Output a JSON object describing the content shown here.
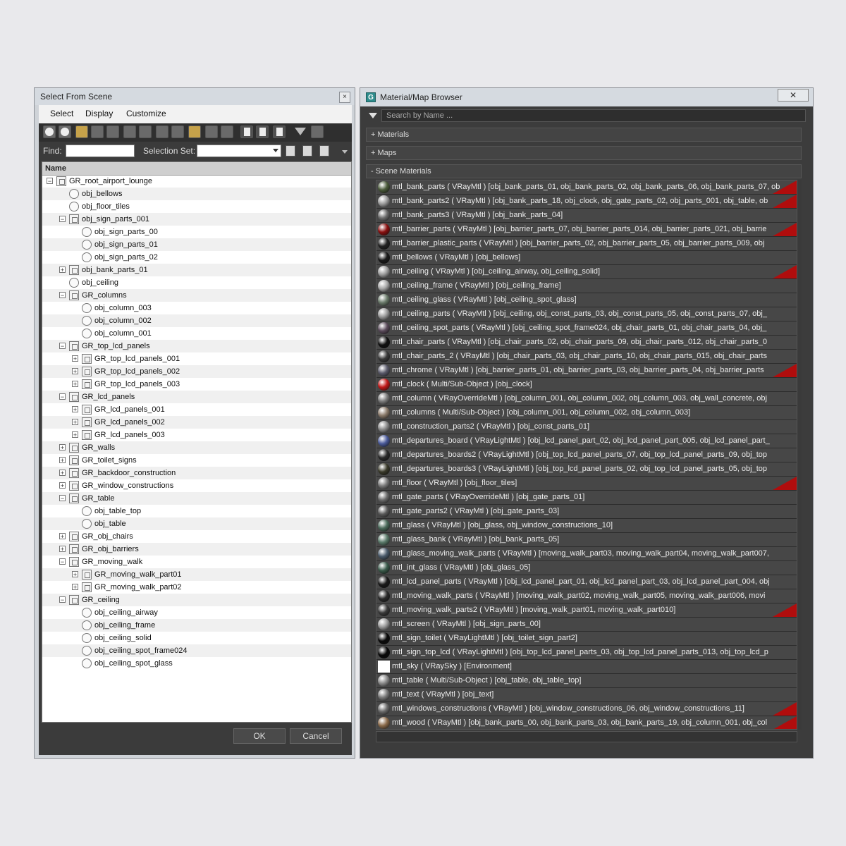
{
  "select_from_scene": {
    "title": "Select From Scene",
    "close": "×",
    "menu": [
      "Select",
      "Display",
      "Customize"
    ],
    "find_label": "Find:",
    "selection_set_label": "Selection Set:",
    "column_header": "Name",
    "buttons": {
      "ok": "OK",
      "cancel": "Cancel"
    },
    "tree": [
      {
        "name": "GR_root_airport_lounge",
        "level": 0,
        "type": "group",
        "expander": "−"
      },
      {
        "name": "obj_bellows",
        "level": 1,
        "type": "object",
        "expander": ""
      },
      {
        "name": "obj_floor_tiles",
        "level": 1,
        "type": "object",
        "expander": ""
      },
      {
        "name": "obj_sign_parts_001",
        "level": 1,
        "type": "group",
        "expander": "−"
      },
      {
        "name": "obj_sign_parts_00",
        "level": 2,
        "type": "object",
        "expander": ""
      },
      {
        "name": "obj_sign_parts_01",
        "level": 2,
        "type": "object",
        "expander": ""
      },
      {
        "name": "obj_sign_parts_02",
        "level": 2,
        "type": "object",
        "expander": ""
      },
      {
        "name": "obj_bank_parts_01",
        "level": 1,
        "type": "group",
        "expander": "+"
      },
      {
        "name": "obj_ceiling",
        "level": 1,
        "type": "object",
        "expander": ""
      },
      {
        "name": "GR_columns",
        "level": 1,
        "type": "group",
        "expander": "−"
      },
      {
        "name": "obj_column_003",
        "level": 2,
        "type": "object",
        "expander": ""
      },
      {
        "name": "obj_column_002",
        "level": 2,
        "type": "object",
        "expander": ""
      },
      {
        "name": "obj_column_001",
        "level": 2,
        "type": "object",
        "expander": ""
      },
      {
        "name": "GR_top_lcd_panels",
        "level": 1,
        "type": "group",
        "expander": "−"
      },
      {
        "name": "GR_top_lcd_panels_001",
        "level": 2,
        "type": "group",
        "expander": "+"
      },
      {
        "name": "GR_top_lcd_panels_002",
        "level": 2,
        "type": "group",
        "expander": "+"
      },
      {
        "name": "GR_top_lcd_panels_003",
        "level": 2,
        "type": "group",
        "expander": "+"
      },
      {
        "name": "GR_lcd_panels",
        "level": 1,
        "type": "group",
        "expander": "−"
      },
      {
        "name": "GR_lcd_panels_001",
        "level": 2,
        "type": "group",
        "expander": "+"
      },
      {
        "name": "GR_lcd_panels_002",
        "level": 2,
        "type": "group",
        "expander": "+"
      },
      {
        "name": "GR_lcd_panels_003",
        "level": 2,
        "type": "group",
        "expander": "+"
      },
      {
        "name": "GR_walls",
        "level": 1,
        "type": "group",
        "expander": "+"
      },
      {
        "name": "GR_toilet_signs",
        "level": 1,
        "type": "group",
        "expander": "+"
      },
      {
        "name": "GR_backdoor_construction",
        "level": 1,
        "type": "group",
        "expander": "+"
      },
      {
        "name": "GR_window_constructions",
        "level": 1,
        "type": "group",
        "expander": "+"
      },
      {
        "name": "GR_table",
        "level": 1,
        "type": "group",
        "expander": "−"
      },
      {
        "name": "obj_table_top",
        "level": 2,
        "type": "object",
        "expander": ""
      },
      {
        "name": "obj_table",
        "level": 2,
        "type": "object",
        "expander": ""
      },
      {
        "name": "GR_obj_chairs",
        "level": 1,
        "type": "group",
        "expander": "+"
      },
      {
        "name": "GR_obj_barriers",
        "level": 1,
        "type": "group",
        "expander": "+"
      },
      {
        "name": "GR_moving_walk",
        "level": 1,
        "type": "group",
        "expander": "−"
      },
      {
        "name": "GR_moving_walk_part01",
        "level": 2,
        "type": "group",
        "expander": "+"
      },
      {
        "name": "GR_moving_walk_part02",
        "level": 2,
        "type": "group",
        "expander": "+"
      },
      {
        "name": "GR_ceiling",
        "level": 1,
        "type": "group",
        "expander": "−"
      },
      {
        "name": "obj_ceiling_airway",
        "level": 2,
        "type": "object",
        "expander": ""
      },
      {
        "name": "obj_ceiling_frame",
        "level": 2,
        "type": "object",
        "expander": ""
      },
      {
        "name": "obj_ceiling_solid",
        "level": 2,
        "type": "object",
        "expander": ""
      },
      {
        "name": "obj_ceiling_spot_frame024",
        "level": 2,
        "type": "object",
        "expander": ""
      },
      {
        "name": "obj_ceiling_spot_glass",
        "level": 2,
        "type": "object",
        "expander": ""
      }
    ]
  },
  "material_browser": {
    "title": "Material/Map Browser",
    "close": "✕",
    "app_icon": "G",
    "search_placeholder": "Search by Name ...",
    "sections": [
      "+ Materials",
      "+ Maps",
      "- Scene Materials"
    ],
    "materials": [
      {
        "label": "mtl_bank_parts ( VRayMtl ) [obj_bank_parts_01, obj_bank_parts_02, obj_bank_parts_06, obj_bank_parts_07, ob",
        "swatch": "#4a5a3a",
        "flag": true
      },
      {
        "label": "mtl_bank_parts2 ( VRayMtl ) [obj_bank_parts_18, obj_clock, obj_gate_parts_02, obj_parts_001, obj_table, ob",
        "swatch": "#9a9a9a",
        "flag": true
      },
      {
        "label": "mtl_bank_parts3 ( VRayMtl ) [obj_bank_parts_04]",
        "swatch": "#6b6b6b",
        "flag": false
      },
      {
        "label": "mtl_barrier_parts ( VRayMtl ) [obj_barrier_parts_07, obj_barrier_parts_014, obj_barrier_parts_021, obj_barrie",
        "swatch": "#8a1010",
        "flag": true
      },
      {
        "label": "mtl_barrier_plastic_parts ( VRayMtl ) [obj_barrier_parts_02, obj_barrier_parts_05, obj_barrier_parts_009, obj",
        "swatch": "#222222",
        "flag": false
      },
      {
        "label": "mtl_bellows ( VRayMtl ) [obj_bellows]",
        "swatch": "#1a1a1a",
        "flag": false
      },
      {
        "label": "mtl_ceiling ( VRayMtl ) [obj_ceiling_airway, obj_ceiling_solid]",
        "swatch": "#9d9d9d",
        "flag": true
      },
      {
        "label": "mtl_ceiling_frame ( VRayMtl ) [obj_ceiling_frame]",
        "swatch": "#a8a8a8",
        "flag": false
      },
      {
        "label": "mtl_ceiling_glass ( VRayMtl ) [obj_ceiling_spot_glass]",
        "swatch": "#6a7a6a",
        "flag": false
      },
      {
        "label": "mtl_ceiling_parts ( VRayMtl ) [obj_ceiling, obj_const_parts_03, obj_const_parts_05, obj_const_parts_07, obj_",
        "swatch": "#9a9a9a",
        "flag": false
      },
      {
        "label": "mtl_ceiling_spot_parts ( VRayMtl ) [obj_ceiling_spot_frame024, obj_chair_parts_01, obj_chair_parts_04, obj_",
        "swatch": "#5a4a5a",
        "flag": false
      },
      {
        "label": "mtl_chair_parts ( VRayMtl ) [obj_chair_parts_02, obj_chair_parts_09, obj_chair_parts_012, obj_chair_parts_0",
        "swatch": "#111111",
        "flag": false
      },
      {
        "label": "mtl_chair_parts_2 ( VRayMtl ) [obj_chair_parts_03, obj_chair_parts_10, obj_chair_parts_015, obj_chair_parts",
        "swatch": "#3a3a3a",
        "flag": false
      },
      {
        "label": "mtl_chrome ( VRayMtl ) [obj_barrier_parts_01, obj_barrier_parts_03, obj_barrier_parts_04, obj_barrier_parts",
        "swatch": "#5a5a6a",
        "flag": true
      },
      {
        "label": "mtl_clock ( Multi/Sub-Object ) [obj_clock]",
        "swatch": "#c01818",
        "flag": false
      },
      {
        "label": "mtl_column ( VRayOverrideMtl ) [obj_column_001, obj_column_002, obj_column_003, obj_wall_concrete, obj",
        "swatch": "#7a7a7a",
        "flag": false
      },
      {
        "label": "mtl_columns ( Multi/Sub-Object ) [obj_column_001, obj_column_002, obj_column_003]",
        "swatch": "#8a7a6a",
        "flag": false
      },
      {
        "label": "mtl_construction_parts2 ( VRayMtl ) [obj_const_parts_01]",
        "swatch": "#8a8a8a",
        "flag": false
      },
      {
        "label": "mtl_departures_board ( VRayLightMtl ) [obj_lcd_panel_part_02, obj_lcd_panel_part_005, obj_lcd_panel_part_",
        "swatch": "#4a5a9a",
        "flag": false
      },
      {
        "label": "mtl_departures_boards2 ( VRayLightMtl ) [obj_top_lcd_panel_parts_07, obj_top_lcd_panel_parts_09, obj_top",
        "swatch": "#2a2a2a",
        "flag": false
      },
      {
        "label": "mtl_departures_boards3 ( VRayLightMtl ) [obj_top_lcd_panel_parts_02, obj_top_lcd_panel_parts_05, obj_top",
        "swatch": "#3a3a2a",
        "flag": false
      },
      {
        "label": "mtl_floor ( VRayMtl ) [obj_floor_tiles]",
        "swatch": "#7a7a7a",
        "flag": true
      },
      {
        "label": "mtl_gate_parts ( VRayOverrideMtl ) [obj_gate_parts_01]",
        "swatch": "#6a6a6a",
        "flag": false
      },
      {
        "label": "mtl_gate_parts2 ( VRayMtl ) [obj_gate_parts_03]",
        "swatch": "#5a5a5a",
        "flag": false
      },
      {
        "label": "mtl_glass ( VRayMtl ) [obj_glass, obj_window_constructions_10]",
        "swatch": "#4a6a5a",
        "flag": false
      },
      {
        "label": "mtl_glass_bank ( VRayMtl ) [obj_bank_parts_05]",
        "swatch": "#5a7a6a",
        "flag": false
      },
      {
        "label": "mtl_glass_moving_walk_parts ( VRayMtl ) [moving_walk_part03, moving_walk_part04, moving_walk_part007, ",
        "swatch": "#4a5a6a",
        "flag": false
      },
      {
        "label": "mtl_int_glass ( VRayMtl ) [obj_glass_05]",
        "swatch": "#3a5a4a",
        "flag": false
      },
      {
        "label": "mtl_lcd_panel_parts ( VRayMtl ) [obj_lcd_panel_part_01, obj_lcd_panel_part_03, obj_lcd_panel_part_004, obj",
        "swatch": "#1a1a1a",
        "flag": false
      },
      {
        "label": "mtl_moving_walk_parts ( VRayMtl ) [moving_walk_part02, moving_walk_part05, moving_walk_part006, movi",
        "swatch": "#2a2a2a",
        "flag": false
      },
      {
        "label": "mtl_moving_walk_parts2 ( VRayMtl ) [moving_walk_part01, moving_walk_part010]",
        "swatch": "#3a3a3a",
        "flag": true
      },
      {
        "label": "mtl_screen ( VRayMtl ) [obj_sign_parts_00]",
        "swatch": "#9a9a9a",
        "flag": false
      },
      {
        "label": "mtl_sign_toilet ( VRayLightMtl ) [obj_toilet_sign_part2]",
        "swatch": "#0a0a0a",
        "flag": false
      },
      {
        "label": "mtl_sign_top_lcd ( VRayLightMtl ) [obj_top_lcd_panel_parts_03, obj_top_lcd_panel_parts_013, obj_top_lcd_p",
        "swatch": "#0a0a0a",
        "flag": false
      },
      {
        "label": "mtl_sky ( VRaySky ) [Environment]",
        "swatch": "#ffffff",
        "flag": false
      },
      {
        "label": "mtl_table ( Multi/Sub-Object ) [obj_table, obj_table_top]",
        "swatch": "#8a8a8a",
        "flag": false
      },
      {
        "label": "mtl_text ( VRayMtl ) [obj_text]",
        "swatch": "#7a7a7a",
        "flag": false
      },
      {
        "label": "mtl_windows_constructions ( VRayMtl ) [obj_window_constructions_06, obj_window_constructions_11]",
        "swatch": "#6a6a6a",
        "flag": true
      },
      {
        "label": "mtl_wood ( VRayMtl ) [obj_bank_parts_00, obj_bank_parts_03, obj_bank_parts_19, obj_column_001, obj_col",
        "swatch": "#8a6a4a",
        "flag": true
      }
    ]
  }
}
